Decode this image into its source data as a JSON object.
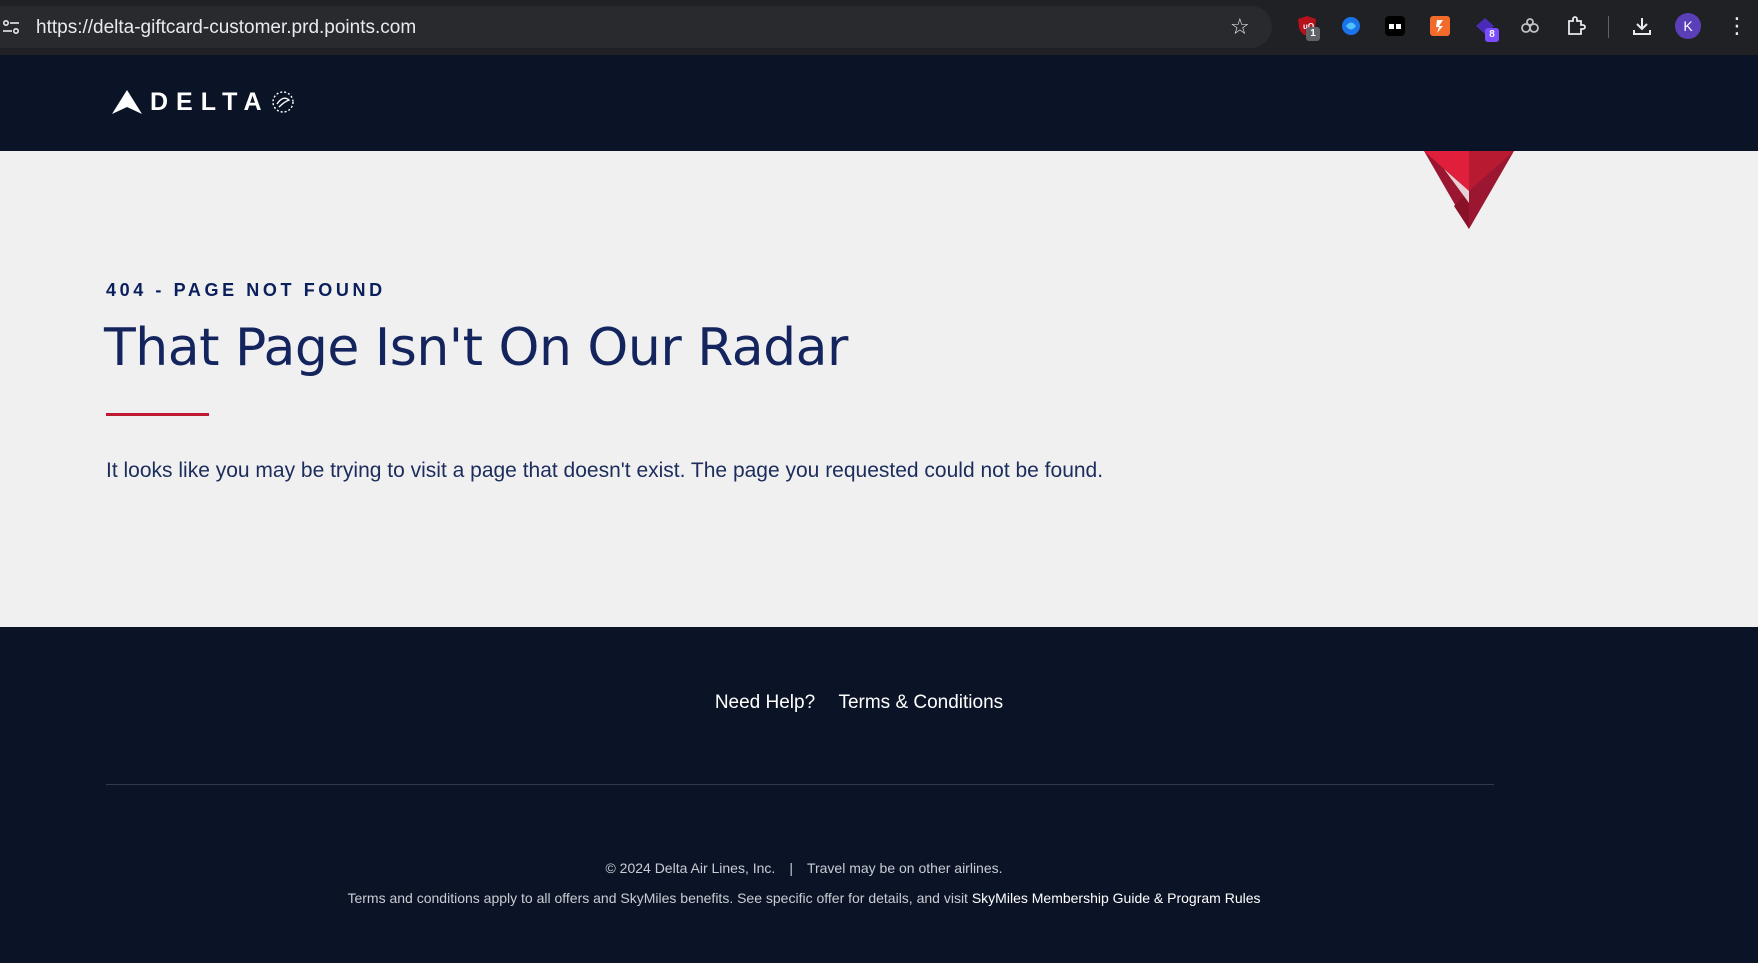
{
  "browser": {
    "url": "https://delta-giftcard-customer.prd.points.com",
    "extensions": [
      {
        "name": "ublock",
        "badge": "1"
      },
      {
        "name": "ext2",
        "badge": ""
      },
      {
        "name": "ext3",
        "badge": ""
      },
      {
        "name": "ext4",
        "badge": ""
      },
      {
        "name": "ext5",
        "badge": "8"
      },
      {
        "name": "ext6",
        "badge": ""
      }
    ],
    "profile_initial": "K"
  },
  "header": {
    "brand_text": "DELTA"
  },
  "main": {
    "eyebrow": "404 - PAGE NOT FOUND",
    "headline": "That Page Isn't On Our Radar",
    "message": "It looks like you may be trying to visit a page that doesn't exist. The page you requested could not be found."
  },
  "footer": {
    "links": [
      "Need Help?",
      "Terms & Conditions"
    ],
    "copyright": "© 2024 Delta Air Lines, Inc.",
    "separator": "|",
    "travel_note": "Travel may be on other airlines.",
    "terms_text": "Terms and conditions apply to all offers and SkyMiles benefits. See specific offer for details, and visit",
    "terms_link": "SkyMiles Membership Guide & Program Rules"
  },
  "colors": {
    "navy": "#0b1426",
    "headline": "#14255e",
    "accent_red": "#c01933",
    "page_bg": "#f0f0f0"
  }
}
